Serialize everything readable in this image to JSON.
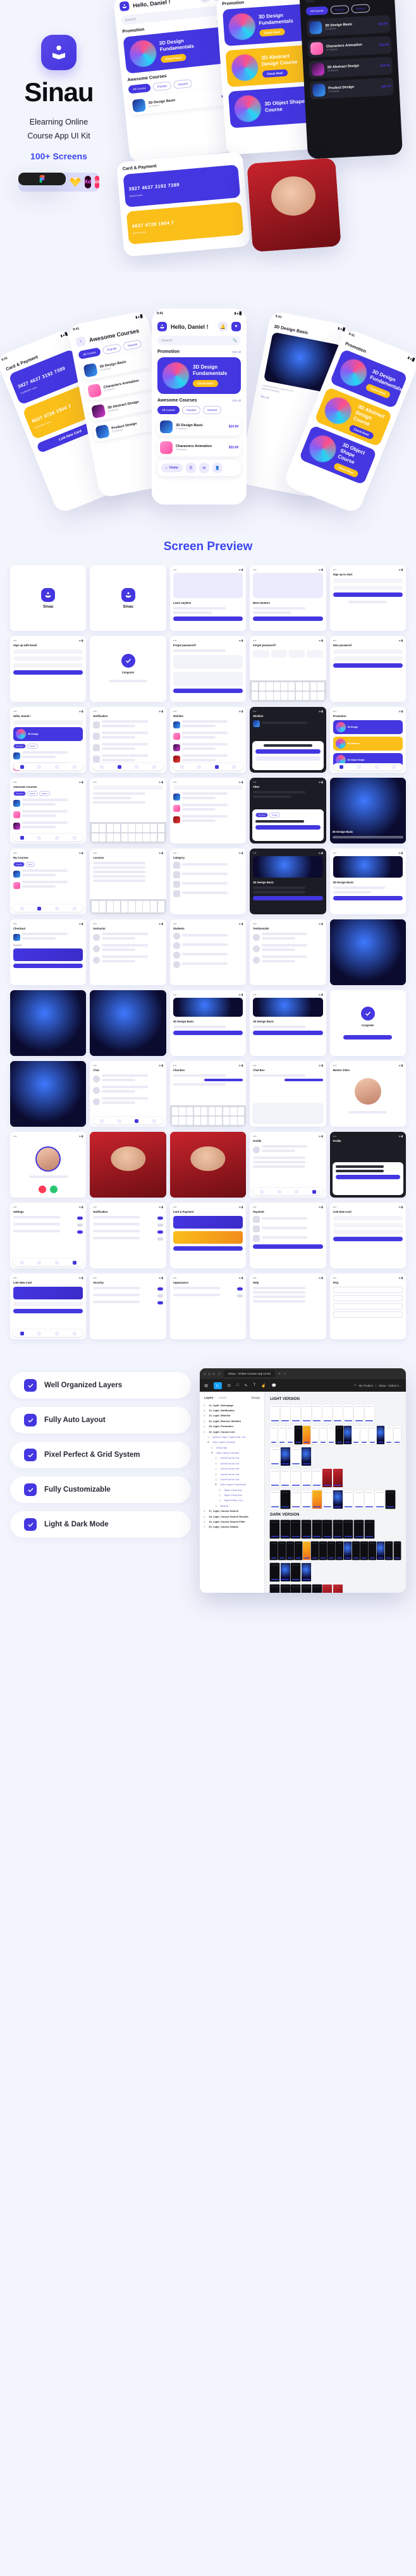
{
  "brand": {
    "name": "Sinau",
    "tagline_line1": "Elearning Online",
    "tagline_line2": "Course App UI Kit",
    "screens_count": "100+ Screens",
    "tools": [
      {
        "name": "figma",
        "label": "F"
      },
      {
        "name": "sketch",
        "label": "S"
      },
      {
        "name": "xd",
        "label": "Xd"
      },
      {
        "name": "invision",
        "label": "in"
      }
    ]
  },
  "section": {
    "preview_title": "Screen Preview"
  },
  "app": {
    "greeting": "Hello, Daniel !",
    "search_placeholder": "Search",
    "promotion_label": "Promotion",
    "see_all": "See all",
    "courses_label": "Awesome Courses",
    "filters": [
      "All Course",
      "Popular",
      "Newest"
    ],
    "status_time": "9:41",
    "nav_home": "Home",
    "promos": [
      {
        "title_line1": "3D Design",
        "title_line2": "Fundamentals",
        "cta": "Check Now!"
      },
      {
        "title_line1": "3D Abstract",
        "title_line2": "Design Course",
        "cta": "Check Now!"
      },
      {
        "title_line1": "3D Object Shape",
        "title_line2": "Course",
        "cta": "Check Now!"
      }
    ],
    "courses": [
      {
        "title": "3D Design Basic",
        "lessons": "24 lessons",
        "rating": "4.5",
        "price": "$24.99"
      },
      {
        "title": "Characters Animation",
        "lessons": "22 lessons",
        "rating": "4.9",
        "price": "$22.69"
      },
      {
        "title": "3D Abstract Design",
        "lessons": "19 lessons",
        "rating": "4.7",
        "price": "$19.29"
      },
      {
        "title": "Product Design",
        "lessons": "21 lessons",
        "rating": "4.8",
        "price": "$25.79"
      }
    ],
    "payment": {
      "title": "Card & Payment",
      "card1_number": "3827 4637 3192 7389",
      "card2_number": "4637 4728 1904 7",
      "holder_label": "Cardholder name",
      "holder_name": "Daniel Austin",
      "expiry": "4239",
      "add_btn": "Link New Card"
    }
  },
  "features": [
    {
      "label": "Well Organized Layers"
    },
    {
      "label": "Fully Auto Layout"
    },
    {
      "label": "Pixel Perfect & Grid System"
    },
    {
      "label": "Fully Customizable"
    },
    {
      "label": "Light & Dark Mode"
    }
  ],
  "figma": {
    "tab_title": "Sinau - Online Course App UI Kit",
    "breadcrumb_user": "My Product",
    "breadcrumb_file": "Sinau - Online C...",
    "panel_tabs": {
      "layers": "Layers",
      "assets": "Assets",
      "design": "Design"
    },
    "light_version_title": "LIGHT VERSION",
    "dark_version_title": "DARK VERSION",
    "layers": [
      {
        "label": "11_Light_Homepage",
        "depth": 0,
        "type": "frame"
      },
      {
        "label": "12_Light_Notification",
        "depth": 0,
        "type": "frame"
      },
      {
        "label": "13_Light_Wishlist",
        "depth": 0,
        "type": "frame"
      },
      {
        "label": "14_Light_Remove Wishlist",
        "depth": 0,
        "type": "frame"
      },
      {
        "label": "15_Light_Promotion",
        "depth": 0,
        "type": "frame"
      },
      {
        "label": "16_Light_Course List",
        "depth": 0,
        "type": "frame"
      },
      {
        "label": "system / light / status bar / de...",
        "depth": 1,
        "type": "component"
      },
      {
        "label": "Auto Layout Vertical",
        "depth": 1,
        "type": "group"
      },
      {
        "label": "Menu Bar",
        "depth": 2,
        "type": "component"
      },
      {
        "label": "Auto Layout Vertical",
        "depth": 2,
        "type": "group"
      },
      {
        "label": "Card/Course List",
        "depth": 3,
        "type": "component"
      },
      {
        "label": "Card/Course List",
        "depth": 3,
        "type": "component"
      },
      {
        "label": "Card/Course List",
        "depth": 3,
        "type": "component"
      },
      {
        "label": "Card/Course List",
        "depth": 3,
        "type": "component"
      },
      {
        "label": "Card/Course List",
        "depth": 3,
        "type": "component"
      },
      {
        "label": "Auto Layout Horizontal",
        "depth": 3,
        "type": "group"
      },
      {
        "label": "Style=Thick Bor...",
        "depth": 4,
        "type": "component"
      },
      {
        "label": "Style=Thick Bor...",
        "depth": 4,
        "type": "component"
      },
      {
        "label": "Style=Filled, Siz...",
        "depth": 4,
        "type": "component"
      },
      {
        "label": "Navbar",
        "depth": 3,
        "type": "component"
      },
      {
        "label": "17_Light_Course Search",
        "depth": 0,
        "type": "frame"
      },
      {
        "label": "18_Light_Course Search Results",
        "depth": 0,
        "type": "frame"
      },
      {
        "label": "19_Light_Course Search Filter",
        "depth": 0,
        "type": "frame"
      },
      {
        "label": "20_Light_Course Details",
        "depth": 0,
        "type": "frame"
      }
    ]
  },
  "colors": {
    "primary": "#4436e0",
    "accent_blue": "#3b46f1",
    "yellow": "#fbbf19",
    "background": "#f3f5fd",
    "dark_surface": "#1c1c24"
  }
}
